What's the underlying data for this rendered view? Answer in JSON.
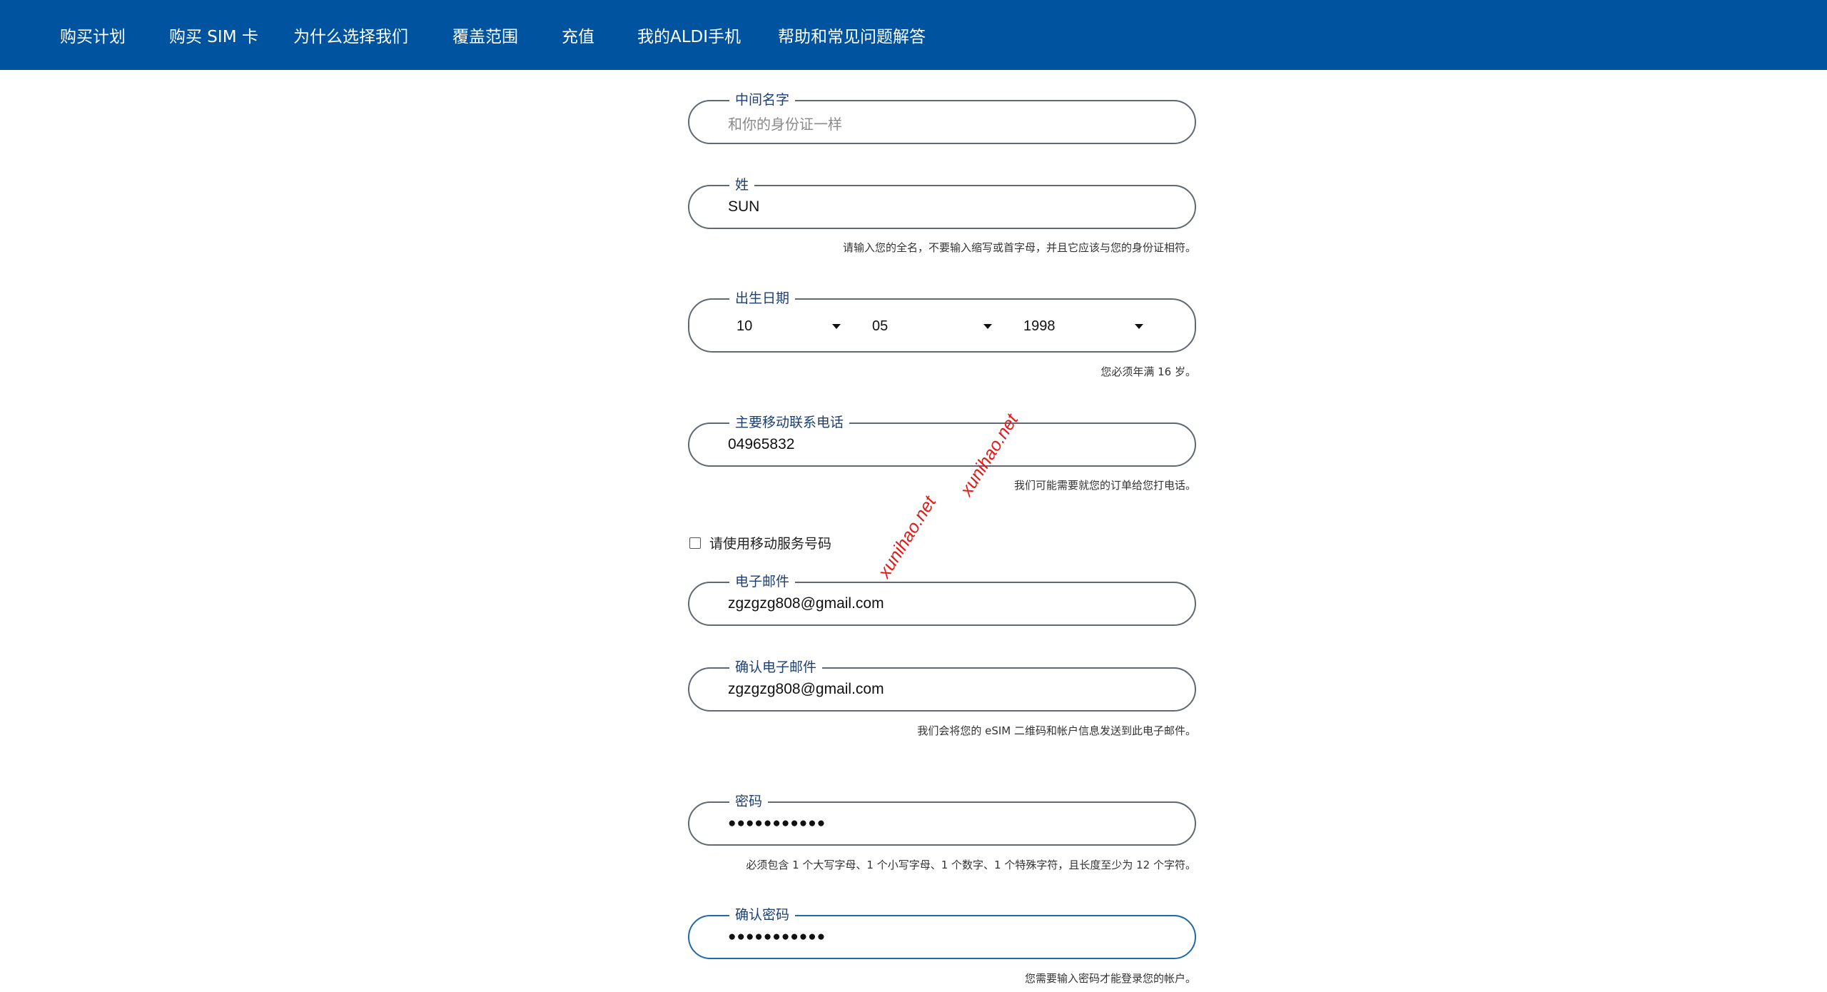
{
  "nav": {
    "items": [
      "购买计划",
      "购买 SIM 卡",
      "为什么选择我们",
      "覆盖范围",
      "充值",
      "我的ALDI手机",
      "帮助和常见问题解答"
    ],
    "background": "#00549f"
  },
  "form": {
    "middle_name": {
      "label": "中间名字",
      "placeholder": "和你的身份证一样"
    },
    "last_name": {
      "label": "姓",
      "value": "SUN",
      "helper": "请输入您的全名，不要输入缩写或首字母，并且它应该与您的身份证相符。"
    },
    "dob": {
      "label": "出生日期",
      "month": "10",
      "day": "05",
      "year": "1998",
      "helper": "您必须年满 16 岁。"
    },
    "mobile": {
      "label": "主要移动联系电话",
      "value": "04965832",
      "helper": "我们可能需要就您的订单给您打电话。"
    },
    "use_mobile_service": {
      "label": "请使用移动服务号码",
      "checked": false
    },
    "email": {
      "label": "电子邮件",
      "value": "zgzgzg808@gmail.com"
    },
    "confirm_email": {
      "label": "确认电子邮件",
      "value": "zgzgzg808@gmail.com",
      "helper": "我们会将您的 eSIM 二维码和帐户信息发送到此电子邮件。"
    },
    "password": {
      "label": "密码",
      "value": "●●●●●●●●●●●",
      "helper": "必须包含 1 个大写字母、1 个小写字母、1 个数字、1 个特殊字符，且长度至少为 12 个字符。"
    },
    "confirm_password": {
      "label": "确认密码",
      "value": "●●●●●●●●●●●",
      "helper": "您需要输入密码才能登录您的帐户。"
    }
  },
  "watermarks": [
    "xunihao.net",
    "xunihao.net"
  ],
  "colors": {
    "accent": "#1f6aa8",
    "label": "#1c3f74",
    "watermark": "#e21a1a"
  }
}
